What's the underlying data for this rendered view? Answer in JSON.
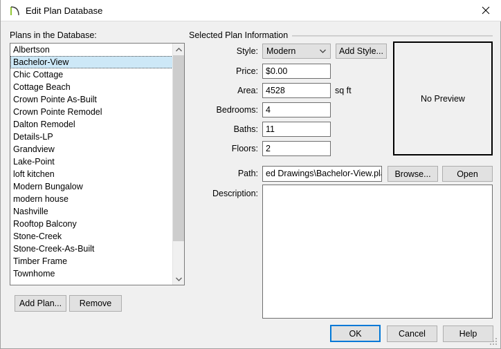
{
  "window": {
    "title": "Edit Plan Database",
    "icon": "plan-curve-icon",
    "close_label": "✕"
  },
  "left_panel": {
    "group_label": "Plans in the Database:",
    "items": [
      "Albertson",
      "Bachelor-View",
      "Chic Cottage",
      "Cottage Beach",
      "Crown Pointe As-Built",
      "Crown Pointe Remodel",
      "Dalton Remodel",
      "Details-LP",
      "Grandview",
      "Lake-Point",
      "loft kitchen",
      "Modern Bungalow",
      "modern house",
      "Nashville",
      "Rooftop Balcony",
      "Stone-Creek",
      "Stone-Creek-As-Built",
      "Timber Frame",
      "Townhome"
    ],
    "selected_index": 1,
    "add_plan_label": "Add Plan...",
    "remove_label": "Remove"
  },
  "right_panel": {
    "group_label": "Selected Plan Information",
    "fields": {
      "style": {
        "label": "Style:",
        "value": "Modern"
      },
      "price": {
        "label": "Price:",
        "value": "$0.00"
      },
      "area": {
        "label": "Area:",
        "value": "4528",
        "unit": "sq ft"
      },
      "bedrooms": {
        "label": "Bedrooms:",
        "value": "4"
      },
      "baths": {
        "label": "Baths:",
        "value": "11"
      },
      "floors": {
        "label": "Floors:",
        "value": "2"
      },
      "path": {
        "label": "Path:",
        "value": "ed Drawings\\Bachelor-View.plan"
      },
      "description": {
        "label": "Description:",
        "value": ""
      }
    },
    "add_style_label": "Add Style...",
    "browse_label": "Browse...",
    "open_label": "Open",
    "preview_text": "No Preview"
  },
  "footer": {
    "ok_label": "OK",
    "cancel_label": "Cancel",
    "help_label": "Help"
  },
  "colors": {
    "accent": "#0078d7",
    "selection": "#cde8f7",
    "dialog_bg": "#f0f0f0",
    "icon_green": "#76b900"
  }
}
